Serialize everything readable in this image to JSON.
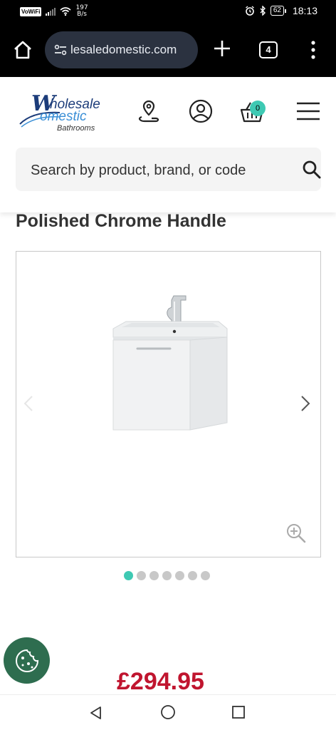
{
  "status_bar": {
    "vowifi": "VoWiFi",
    "speed_value": "197",
    "speed_unit": "B/s",
    "battery": "62",
    "time": "18:13"
  },
  "browser": {
    "url": "lesaledomestic.com",
    "tab_count": "4"
  },
  "site": {
    "logo": {
      "line1": "holesale",
      "line1_initial": "W",
      "line2": "omestic",
      "line3": "Bathrooms"
    },
    "basket_count": "0",
    "search": {
      "placeholder": "Search by product, brand, or code"
    }
  },
  "product": {
    "title": "Polished Chrome Handle",
    "price": "£294.95",
    "gallery": {
      "image_count": 7,
      "active_index": 0
    }
  },
  "colors": {
    "accent": "#3ec9b3",
    "price": "#c0152f",
    "cookie": "#2e6d4f",
    "brand_dark": "#1c3c7a",
    "brand_light": "#3b8fd6"
  }
}
